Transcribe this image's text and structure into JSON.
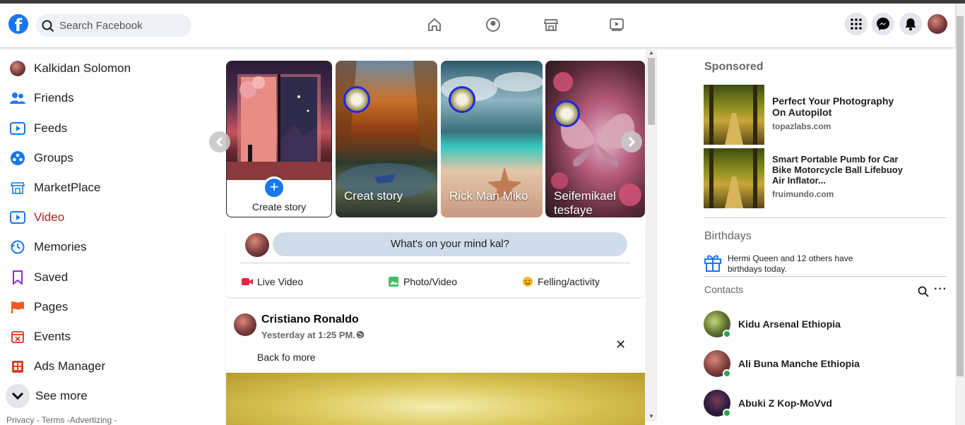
{
  "header": {
    "logo": "f",
    "search_placeholder": "Search Facebook",
    "nav_icons": [
      "home-icon",
      "profile-icon",
      "marketplace-icon",
      "watch-icon"
    ],
    "right_icons": [
      "menu-grid-icon",
      "messenger-icon",
      "notifications-icon",
      "account-avatar"
    ]
  },
  "sidebar": {
    "items": [
      {
        "label": "Kalkidan Solomon",
        "icon": "profile-avatar"
      },
      {
        "label": "Friends",
        "icon": "friends-icon"
      },
      {
        "label": "Feeds",
        "icon": "feeds-icon"
      },
      {
        "label": "Groups",
        "icon": "groups-icon"
      },
      {
        "label": "MarketPlace",
        "icon": "marketplace-icon"
      },
      {
        "label": "Video",
        "icon": "video-icon"
      },
      {
        "label": "Memories",
        "icon": "memories-icon"
      },
      {
        "label": "Saved",
        "icon": "saved-icon"
      },
      {
        "label": "Pages",
        "icon": "pages-icon"
      },
      {
        "label": "Events",
        "icon": "events-icon"
      },
      {
        "label": "Ads Manager",
        "icon": "ads-manager-icon"
      }
    ],
    "see_more": "See more",
    "footer": "Privacy - Terms -Advertizing -"
  },
  "stories": {
    "create_label": "Create story",
    "items": [
      {
        "name": "Creat story"
      },
      {
        "name": "Rick Man Miko"
      },
      {
        "name": "Seifemikael tesfaye"
      }
    ]
  },
  "composer": {
    "prompt": "What's on your mind kal?",
    "actions": [
      {
        "label": "Live Video",
        "icon": "live-video-icon",
        "color": "#e42645"
      },
      {
        "label": "Photo/Video",
        "icon": "photo-video-icon",
        "color": "#45bd62"
      },
      {
        "label": "Felling/activity",
        "icon": "feeling-icon",
        "color": "#f7b928"
      }
    ]
  },
  "post": {
    "author": "Cristiano Ronaldo",
    "time": "Yesterday at 1:25 PM.",
    "text": "Back fo more"
  },
  "right": {
    "sponsored_title": "Sponsored",
    "ads": [
      {
        "title": "Perfect Your Photography On Autopilot",
        "site": "topazlabs.com"
      },
      {
        "title": "Smart Portable Pumb for Car Bike Motorcycle Ball Lifebuoy Air Inflator...",
        "site": "fruimundo.com"
      }
    ],
    "birthdays_title": "Birthdays",
    "birthday_text": "Hermi Queen and 12 others have birthdays today.",
    "contacts_title": "Contacts",
    "contacts": [
      {
        "name": "Kidu Arsenal Ethiopia"
      },
      {
        "name": "Ali Buna Manche Ethiopia"
      },
      {
        "name": "Abuki Z Kop-MoVvd"
      }
    ]
  },
  "colors": {
    "brand": "#1877f2",
    "active_video": "#b11f1f",
    "online": "#31a24c"
  }
}
